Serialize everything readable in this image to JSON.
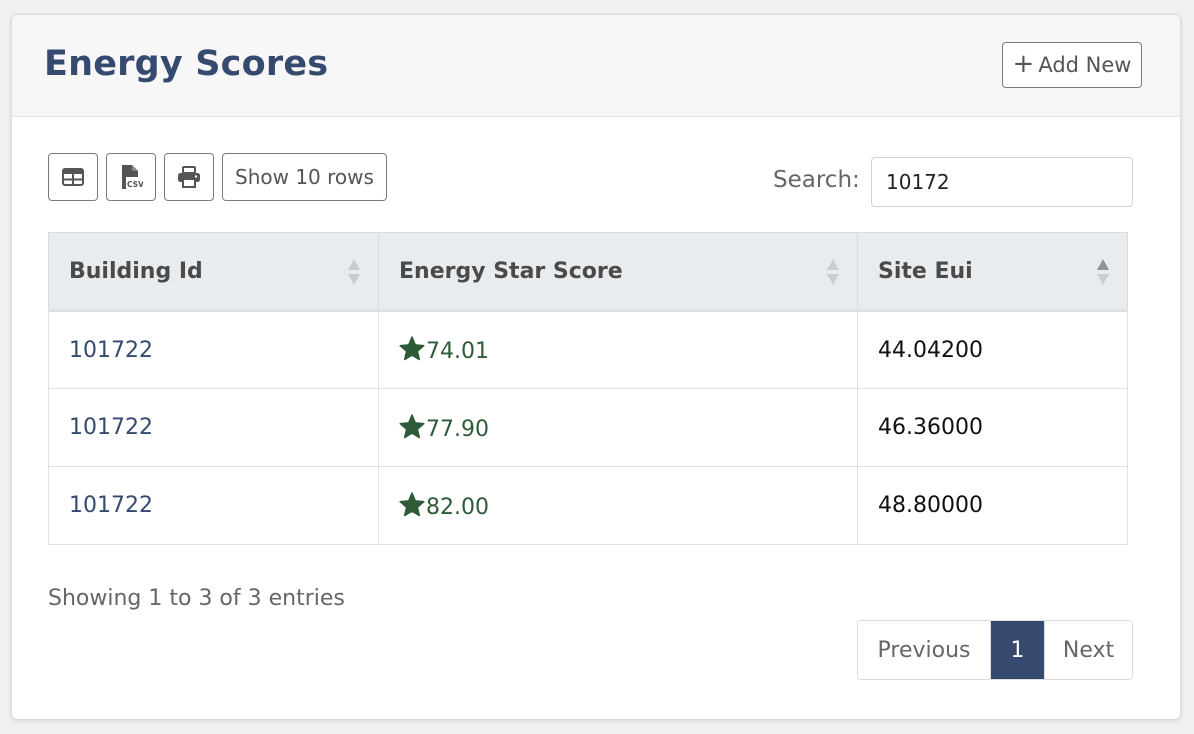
{
  "header": {
    "title": "Energy Scores",
    "add_new_label": "Add New"
  },
  "toolbar": {
    "buttons": [
      {
        "name": "table-view-button",
        "icon": "table-icon"
      },
      {
        "name": "csv-export-button",
        "icon": "csv-file-icon"
      },
      {
        "name": "print-button",
        "icon": "print-icon"
      }
    ],
    "rows_label": "Show 10 rows"
  },
  "search": {
    "label": "Search:",
    "value": "10172"
  },
  "table": {
    "columns": [
      {
        "label": "Building Id",
        "sort": "none"
      },
      {
        "label": "Energy Star Score",
        "sort": "none"
      },
      {
        "label": "Site Eui",
        "sort": "asc"
      }
    ],
    "rows": [
      {
        "building_id": "101722",
        "score": "74.01",
        "eui": "44.04200"
      },
      {
        "building_id": "101722",
        "score": "77.90",
        "eui": "46.36000"
      },
      {
        "building_id": "101722",
        "score": "82.00",
        "eui": "48.80000"
      }
    ],
    "score_icon": "star-icon"
  },
  "footer": {
    "info": "Showing 1 to 3 of 3 entries",
    "pagination": {
      "previous": "Previous",
      "current": "1",
      "next": "Next"
    }
  },
  "colors": {
    "brand": "#364a70",
    "score": "#2f5a37"
  }
}
